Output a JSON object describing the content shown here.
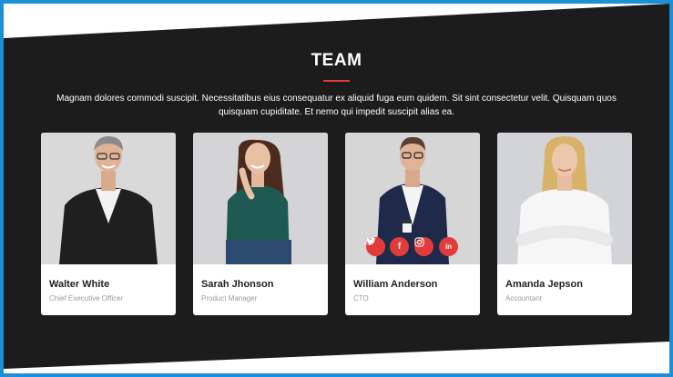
{
  "section": {
    "title": "TEAM",
    "description": "Magnam dolores commodi suscipit. Necessitatibus eius consequatur ex aliquid fuga eum quidem. Sit sint consectetur velit. Quisquam quos quisquam cupiditate. Et nemo qui impedit suscipit alias ea."
  },
  "colors": {
    "accent": "#e23b3b",
    "background": "#1c1c1c",
    "frame_border": "#1b8fd8"
  },
  "team": [
    {
      "name": "Walter White",
      "role": "Chief Executive Officer"
    },
    {
      "name": "Sarah Jhonson",
      "role": "Product Manager"
    },
    {
      "name": "William Anderson",
      "role": "CTO"
    },
    {
      "name": "Amanda Jepson",
      "role": "Accountant"
    }
  ],
  "social_icons": [
    {
      "icon": "twitter-icon",
      "glyph": "🐦"
    },
    {
      "icon": "facebook-icon",
      "glyph": "f"
    },
    {
      "icon": "instagram-icon",
      "glyph": "◎"
    },
    {
      "icon": "linkedin-icon",
      "glyph": "in"
    }
  ]
}
